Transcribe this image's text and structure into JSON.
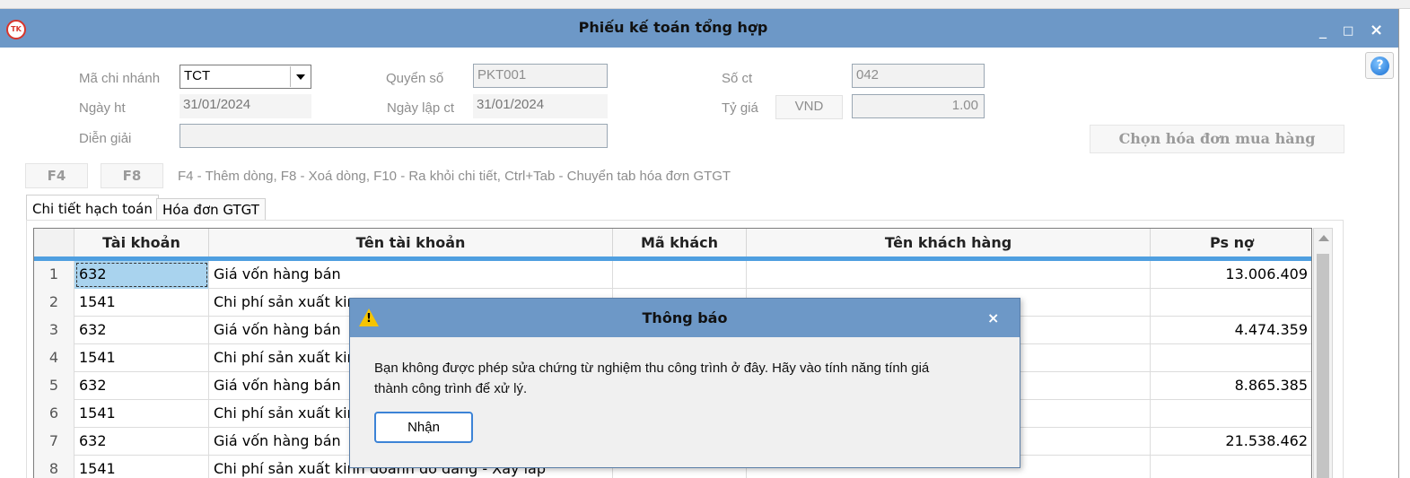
{
  "window": {
    "title": "Phiếu kế toán tổng hợp",
    "logo_text": "TK",
    "controls": {
      "minimize": "_",
      "maximize": "□",
      "close": "×"
    }
  },
  "help": {
    "icon": "?"
  },
  "form": {
    "branch": {
      "label": "Mã chi nhánh",
      "value": "TCT"
    },
    "book": {
      "label": "Quyển số",
      "value": "PKT001"
    },
    "doc_no": {
      "label": "Số ct",
      "value": "042"
    },
    "posting_date": {
      "label": "Ngày ht",
      "value": "31/01/2024"
    },
    "doc_date": {
      "label": "Ngày lập ct",
      "value": "31/01/2024"
    },
    "rate": {
      "label": "Tỷ giá",
      "currency": "VND",
      "value": "1.00"
    },
    "description": {
      "label": "Diễn giải",
      "value": ""
    },
    "select_invoice_button": "Chọn hóa đơn mua hàng"
  },
  "shortcuts": {
    "f4": "F4",
    "f8": "F8",
    "hint": "F4 - Thêm dòng, F8 - Xoá dòng, F10 - Ra khỏi chi tiết, Ctrl+Tab - Chuyển tab hóa đơn GTGT"
  },
  "tabs": [
    {
      "label": "Chi tiết hạch toán",
      "active": true
    },
    {
      "label": "Hóa đơn GTGT",
      "active": false
    }
  ],
  "grid": {
    "columns": [
      "Tài khoản",
      "Tên tài khoản",
      "Mã khách",
      "Tên khách hàng",
      "Ps nợ"
    ],
    "rows": [
      {
        "no": "1",
        "account": "632",
        "name": "Giá vốn hàng bán",
        "customer_code": "",
        "customer_name": "",
        "debit": "13.006.409"
      },
      {
        "no": "2",
        "account": "1541",
        "name": "Chi phí sản xuất kin",
        "customer_code": "",
        "customer_name": "",
        "debit": ""
      },
      {
        "no": "3",
        "account": "632",
        "name": "Giá vốn hàng bán",
        "customer_code": "",
        "customer_name": "",
        "debit": "4.474.359"
      },
      {
        "no": "4",
        "account": "1541",
        "name": "Chi phí sản xuất kin",
        "customer_code": "",
        "customer_name": "",
        "debit": ""
      },
      {
        "no": "5",
        "account": "632",
        "name": "Giá vốn hàng bán",
        "customer_code": "",
        "customer_name": "",
        "debit": "8.865.385"
      },
      {
        "no": "6",
        "account": "1541",
        "name": "Chi phí sản xuất kin",
        "customer_code": "",
        "customer_name": "",
        "debit": ""
      },
      {
        "no": "7",
        "account": "632",
        "name": "Giá vốn hàng bán",
        "customer_code": "",
        "customer_name": "",
        "debit": "21.538.462"
      },
      {
        "no": "8",
        "account": "1541",
        "name": "Chi phí sản xuất kinh doanh dở dang - Xây lắp",
        "customer_code": "",
        "customer_name": "",
        "debit": ""
      }
    ]
  },
  "dialog": {
    "title": "Thông báo",
    "warning_glyph": "!",
    "close": "×",
    "message_line1": "Bạn không được phép sửa chứng từ nghiệm thu công trình ở đây. Hãy vào tính năng tính giá",
    "message_line2": "thành công trình để xử lý.",
    "ok_button": "Nhận"
  },
  "colors": {
    "titlebar": "#6d98c7",
    "grid_header_accent": "#4f9fe0",
    "selected_cell": "#a9d3ee",
    "dialog_button_border": "#3c83d6",
    "warning": "#f5c400"
  }
}
